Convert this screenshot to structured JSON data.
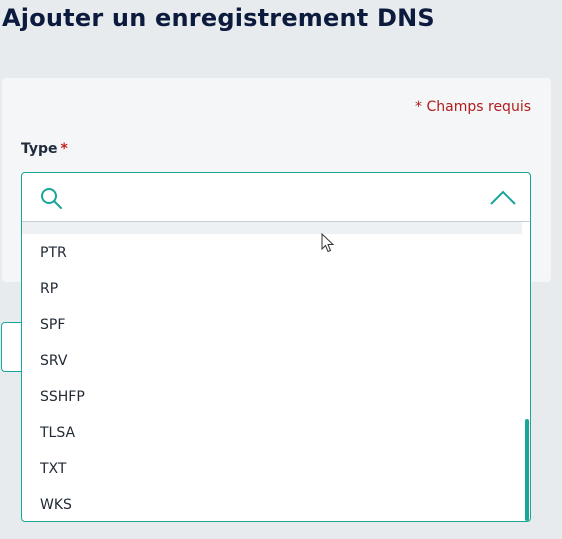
{
  "page": {
    "title": "Ajouter un enregistrement DNS"
  },
  "form": {
    "required_note": "* Champs requis",
    "type_field": {
      "label": "Type",
      "required_marker": "*",
      "search_placeholder": "",
      "options": [
        "PTR",
        "RP",
        "SPF",
        "SRV",
        "SSHFP",
        "TLSA",
        "TXT",
        "WKS"
      ]
    }
  },
  "icons": {
    "search": "search-icon",
    "collapse": "chevron-up-icon",
    "cursor": "mouse-pointer-icon"
  },
  "colors": {
    "accent": "#1aa59b",
    "title": "#0c1a3d",
    "required": "#b01c1c",
    "background": "#e8ebee"
  }
}
